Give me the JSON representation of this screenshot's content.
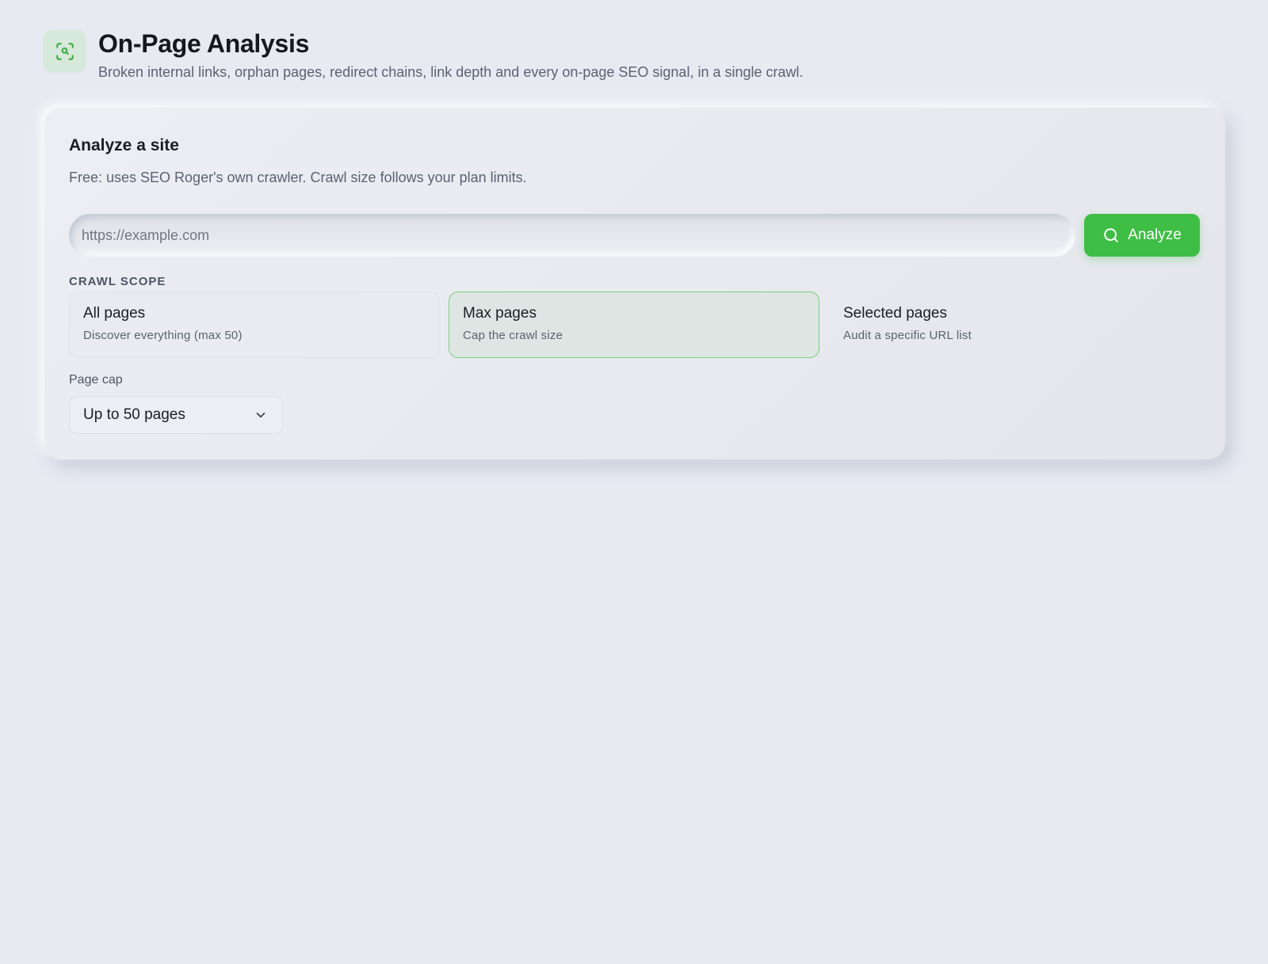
{
  "header": {
    "title": "On-Page Analysis",
    "subtitle": "Broken internal links, orphan pages, redirect chains, link depth and every on-page SEO signal, in a single crawl.",
    "icon": "scan-search-icon"
  },
  "card": {
    "title": "Analyze a site",
    "description": "Free: uses SEO Roger's own crawler. Crawl size follows your plan limits.",
    "url_input": {
      "value": "",
      "placeholder": "https://example.com"
    },
    "analyze_button": {
      "label": "Analyze",
      "icon": "search-icon"
    },
    "crawl_scope": {
      "label": "CRAWL SCOPE",
      "selected_index": 1,
      "options": [
        {
          "title": "All pages",
          "description": "Discover everything (max 50)"
        },
        {
          "title": "Max pages",
          "description": "Cap the crawl size"
        },
        {
          "title": "Selected pages",
          "description": "Audit a specific URL list"
        }
      ]
    },
    "page_cap": {
      "label": "Page cap",
      "selected_value": "Up to 50 pages",
      "icon": "chevron-down-icon"
    }
  },
  "colors": {
    "background": "#e7eaf1",
    "accent": "#3fbe45",
    "selected_border": "#7ccf7f",
    "icon_tile": "#d6e9da"
  }
}
